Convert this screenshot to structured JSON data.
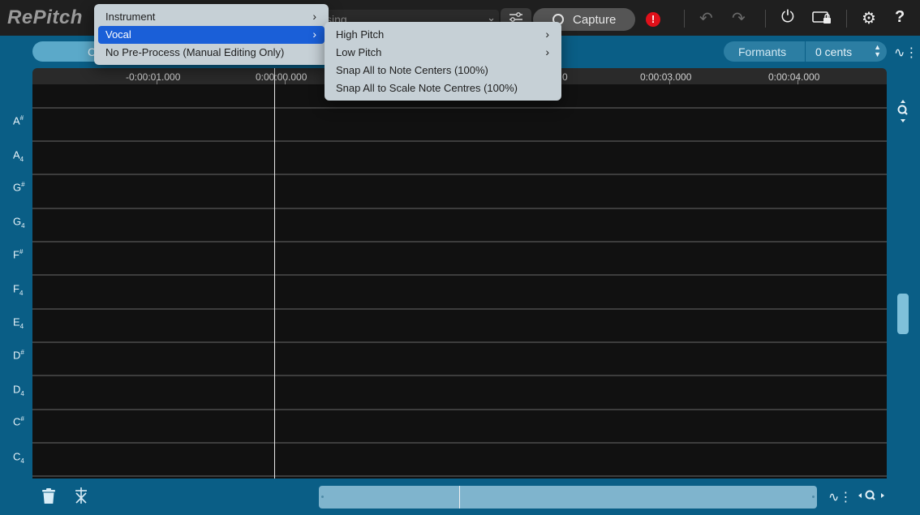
{
  "app": {
    "title": "RePitch"
  },
  "toolbar": {
    "process_text": "ssing",
    "capture_label": "Capture",
    "record_symbol": "!"
  },
  "context_menu": {
    "items": [
      {
        "label": "Instrument",
        "has_submenu": true,
        "selected": false
      },
      {
        "label": "Vocal",
        "has_submenu": true,
        "selected": true
      },
      {
        "label": "No Pre-Process (Manual Editing Only)",
        "has_submenu": false,
        "selected": false
      }
    ]
  },
  "submenu": {
    "items": [
      {
        "label": "High Pitch",
        "has_submenu": true
      },
      {
        "label": "Low Pitch",
        "has_submenu": true
      },
      {
        "label": "Snap All to Note Centers (100%)",
        "has_submenu": false
      },
      {
        "label": "Snap All to Scale Note Centres (100%)",
        "has_submenu": false
      }
    ]
  },
  "controls": {
    "left_pill_text": "C",
    "formants_label": "Formants",
    "cents_value": "0 cents"
  },
  "timeline": {
    "ticks": [
      "-0:00:01.000",
      "0:00:00.000",
      "0",
      "0:00:03.000",
      "0:00:04.000"
    ]
  },
  "piano_roll": {
    "note_labels": [
      {
        "letter": "A",
        "mark": "#",
        "octave": ""
      },
      {
        "letter": "A",
        "mark": "",
        "octave": "4"
      },
      {
        "letter": "G",
        "mark": "#",
        "octave": ""
      },
      {
        "letter": "G",
        "mark": "",
        "octave": "4"
      },
      {
        "letter": "F",
        "mark": "#",
        "octave": ""
      },
      {
        "letter": "F",
        "mark": "",
        "octave": "4"
      },
      {
        "letter": "E",
        "mark": "",
        "octave": "4"
      },
      {
        "letter": "D",
        "mark": "#",
        "octave": ""
      },
      {
        "letter": "D",
        "mark": "",
        "octave": "4"
      },
      {
        "letter": "C",
        "mark": "#",
        "octave": ""
      },
      {
        "letter": "C",
        "mark": "",
        "octave": "4"
      }
    ]
  },
  "colors": {
    "background": "#0a5e86",
    "topbar": "#1f1f1f",
    "menu": "#c6d0d6",
    "menu_selected": "#1a5fd8",
    "record": "#e0101a"
  }
}
